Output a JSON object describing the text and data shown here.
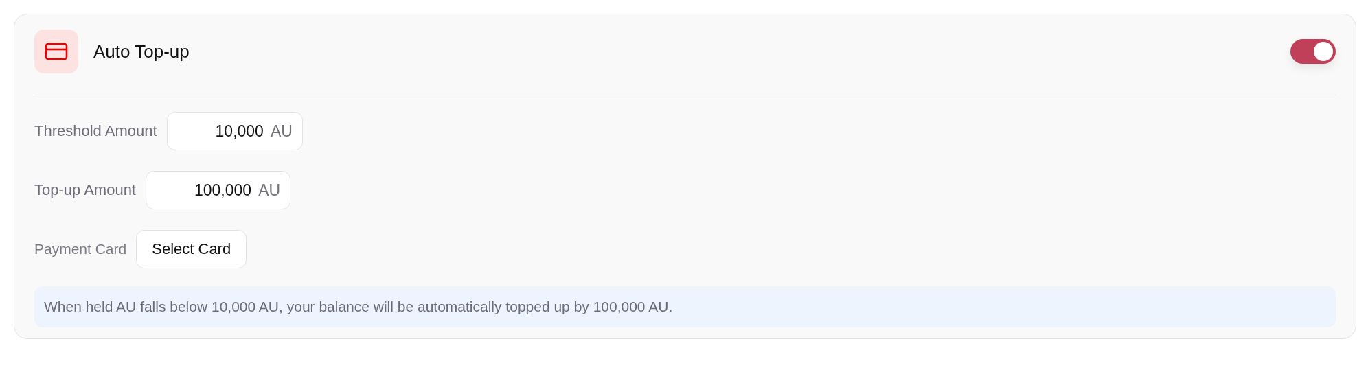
{
  "card": {
    "title": "Auto Top-up",
    "enabled": true
  },
  "fields": [
    {
      "kind": "amount",
      "label": "Threshold Amount",
      "value": "10,000",
      "unit": "AU"
    },
    {
      "kind": "amount",
      "label": "Top-up Amount",
      "value": "100,000",
      "unit": "AU"
    },
    {
      "kind": "button",
      "label": "Payment Card",
      "button": "Select Card"
    }
  ],
  "info": "When held AU falls below 10,000 AU, your balance will be automatically topped up by 100,000 AU."
}
